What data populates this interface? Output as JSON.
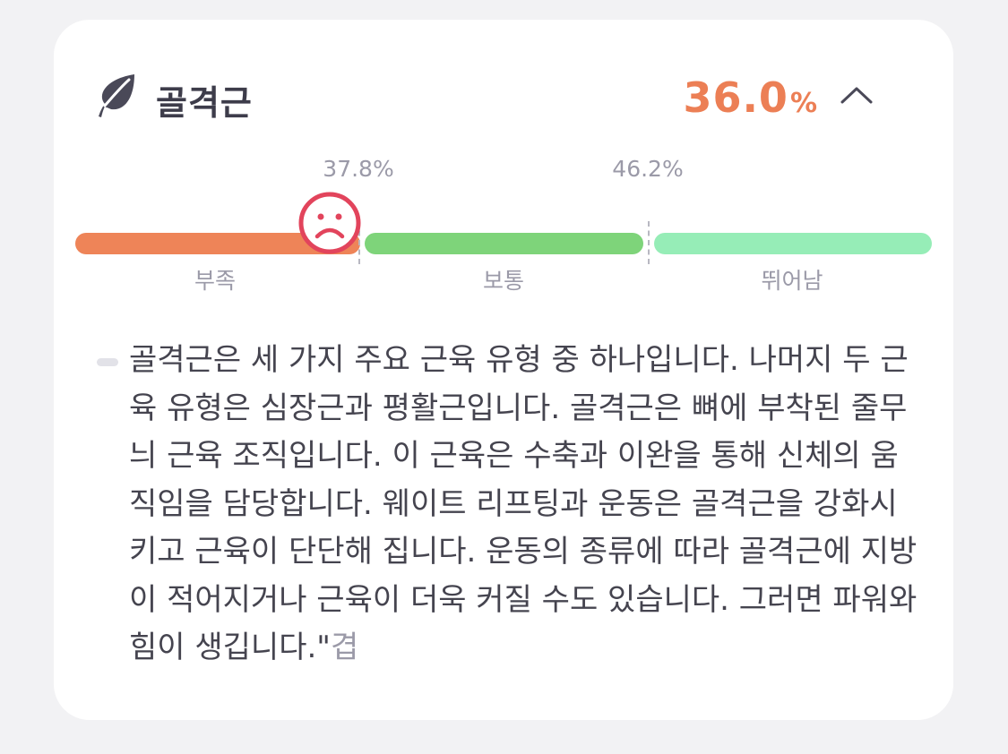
{
  "card": {
    "title": "골격근",
    "icon": "leaf-icon",
    "value": "36.0",
    "value_unit": "%",
    "expand_icon": "chevron-up-icon",
    "accent_color": "#ec7f55"
  },
  "gauge": {
    "current_percent": 36.0,
    "thresholds": [
      {
        "label": "37.8%",
        "value": 37.8
      },
      {
        "label": "46.2%",
        "value": 46.2
      }
    ],
    "ranges": [
      {
        "label": "부족",
        "color": "#ee8458"
      },
      {
        "label": "보통",
        "color": "#7ed47a"
      },
      {
        "label": "뛰어남",
        "color": "#96edb7"
      }
    ],
    "indicator_icon": "sad-face-icon",
    "indicator_color": "#e2445c"
  },
  "description": {
    "text": "골격근은 세 가지 주요 근육 유형 중 하나입니다. 나머지 두 근육 유형은 심장근과 평활근입니다. 골격근은 뼈에 부착된 줄무늬 근육 조직입니다. 이 근육은 수축과 이완을 통해 신체의 움직임을 담당합니다. 웨이트 리프팅과 운동은 골격근을 강화시키고 근육이 단단해 집니다. 운동의 종류에 따라 골격근에 지방이 적어지거나 근육이 더욱 커질 수도 있습니다. 그러면 파워와 힘이 생깁니다.\"",
    "more_label": "겹"
  }
}
